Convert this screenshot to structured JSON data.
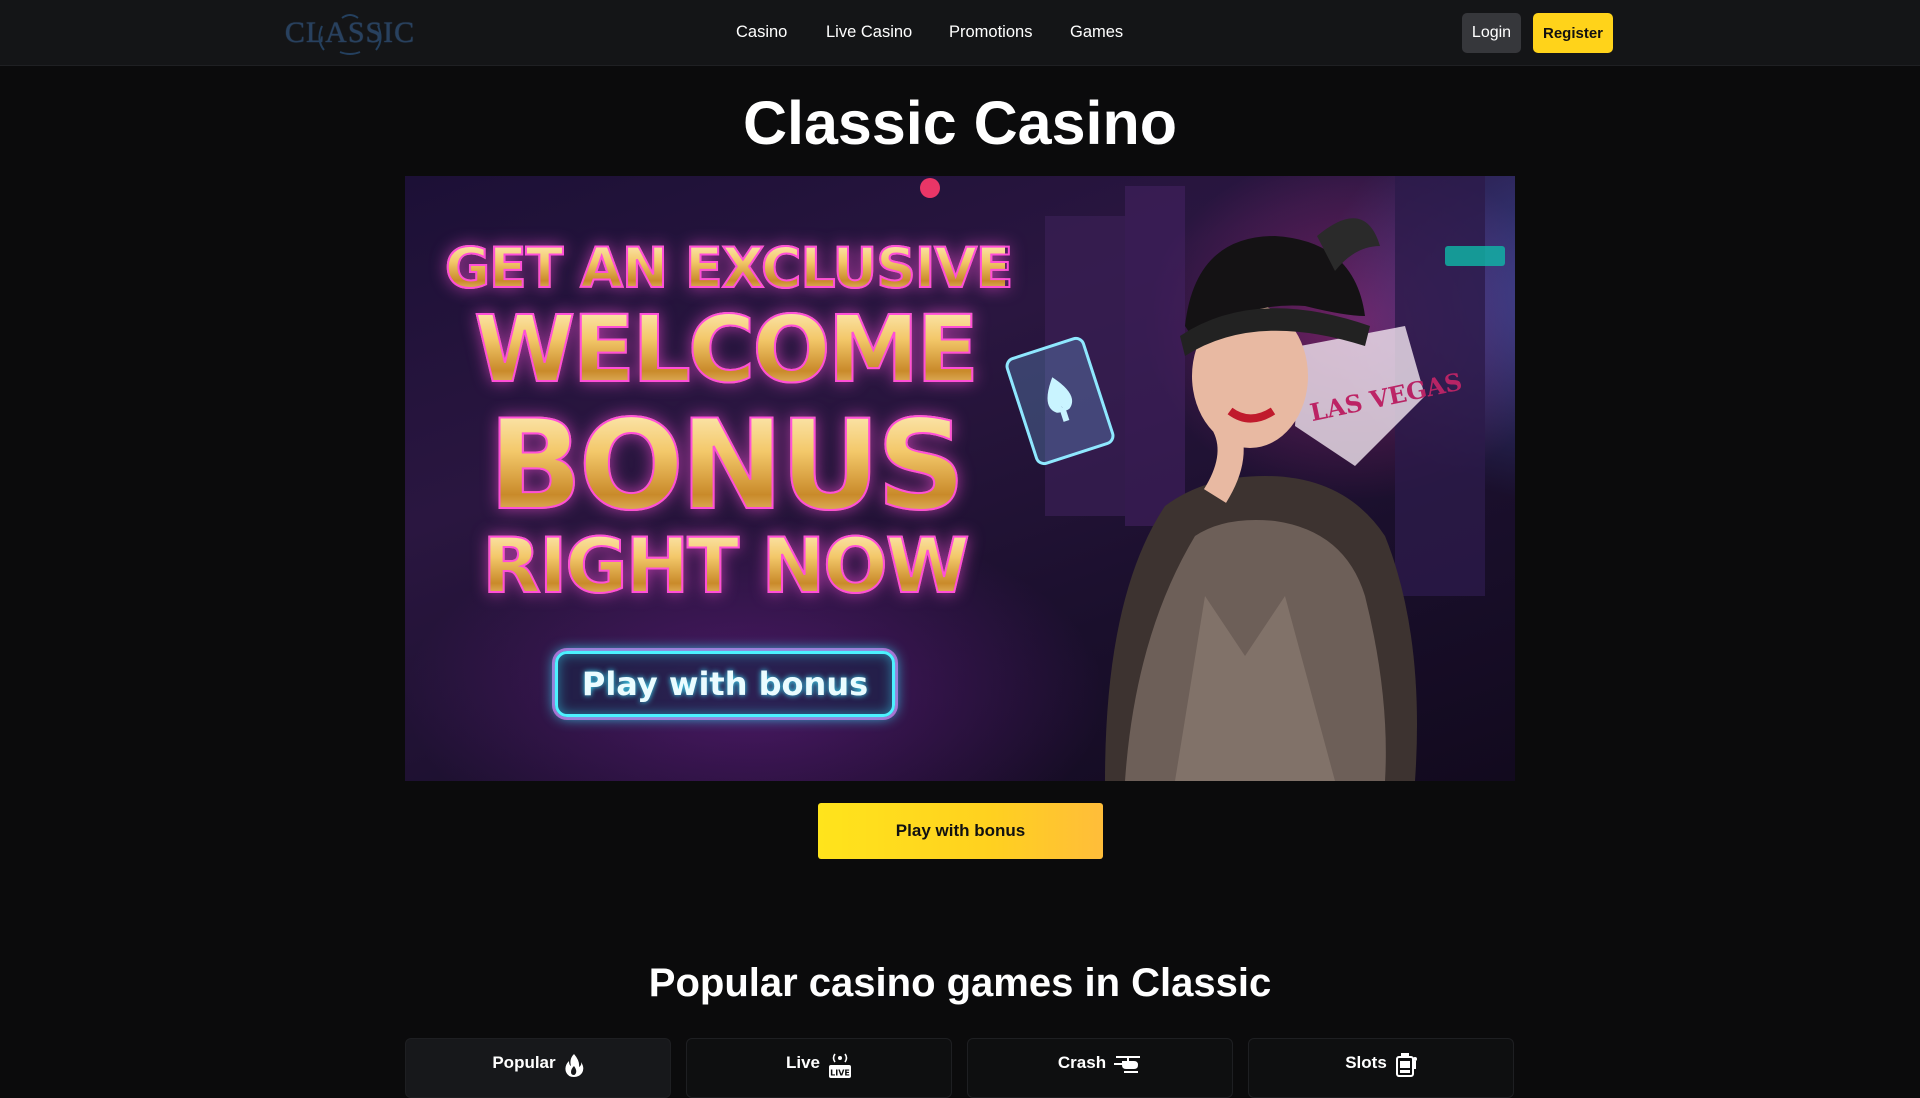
{
  "header": {
    "logo_text": "CLASSIC",
    "nav": [
      "Casino",
      "Live Casino",
      "Promotions",
      "Games"
    ],
    "login_label": "Login",
    "register_label": "Register"
  },
  "page_title": "Classic Casino",
  "banner": {
    "lines": [
      "GET AN EXCLUSIVE",
      "WELCOME",
      "BONUS",
      "RIGHT NOW"
    ],
    "cta_label": "Play with bonus",
    "sign_text": "LAS VEGAS"
  },
  "cta_label": "Play with bonus",
  "games_section": {
    "title": "Popular casino games in Classic",
    "tabs": [
      {
        "label": "Popular",
        "icon": "flame-icon"
      },
      {
        "label": "Live",
        "icon": "live-icon"
      },
      {
        "label": "Crash",
        "icon": "helicopter-icon"
      },
      {
        "label": "Slots",
        "icon": "slot-machine-icon"
      }
    ]
  },
  "colors": {
    "background": "#0b0b0c",
    "header": "#141517",
    "accent": "#ffd31a",
    "login_button": "#36373b"
  }
}
